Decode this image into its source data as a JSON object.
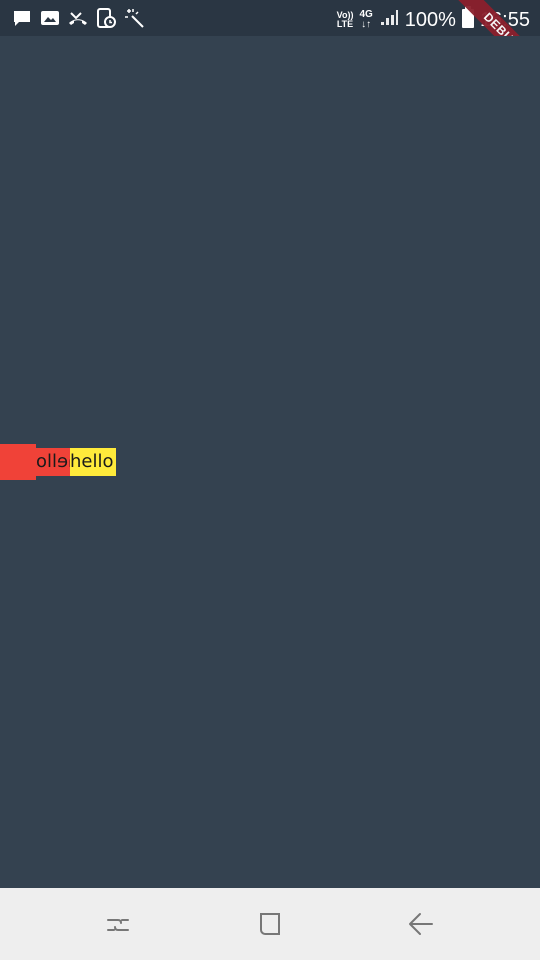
{
  "status_bar": {
    "left_icons": [
      "message-icon",
      "image-icon",
      "missed-call-icon",
      "phone-clock-icon",
      "magic-wand-icon"
    ],
    "volte_label": "Vo))\nLTE",
    "network_label": "4G",
    "battery_percent": "100%",
    "time": "16:55"
  },
  "debug_banner": {
    "label": "DEBUG"
  },
  "content": {
    "mirrored_text": "hello",
    "text": "hello",
    "colors": {
      "background": "#344250",
      "red": "#f04238",
      "yellow": "#ffeb3b"
    }
  },
  "nav_bar": {
    "buttons": [
      "recent-apps-icon",
      "home-icon",
      "back-icon"
    ]
  }
}
